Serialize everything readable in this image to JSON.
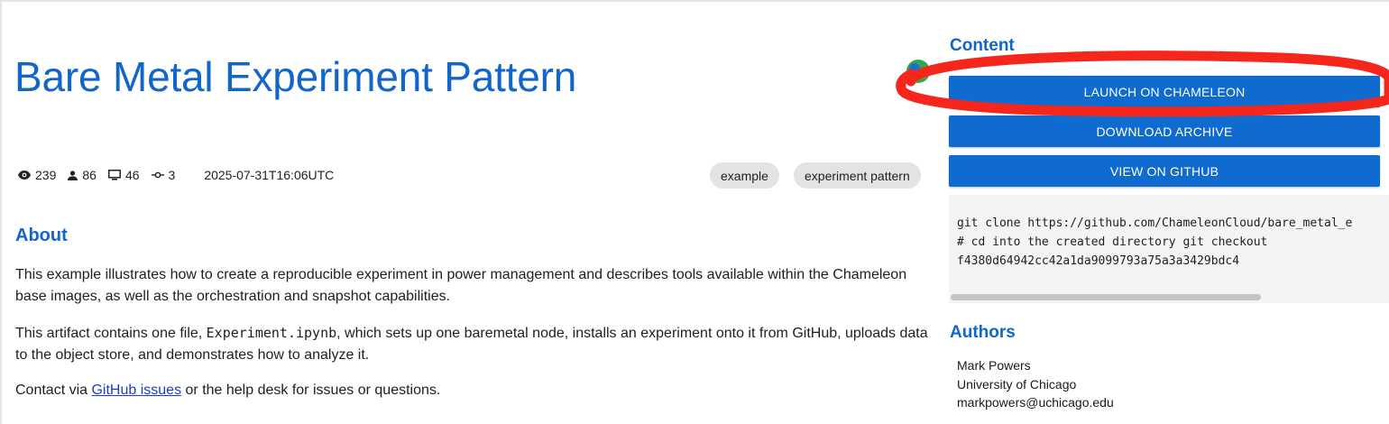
{
  "artifact": {
    "title": "Bare Metal Experiment Pattern",
    "stats": {
      "views": "239",
      "users": "86",
      "launches": "46",
      "versions": "3"
    },
    "date": "2025-07-31T16:06UTC",
    "tags": [
      "example",
      "experiment pattern"
    ]
  },
  "about": {
    "heading": "About",
    "p1": "This example illustrates how to create a reproducible experiment in power management and describes tools available within the Chameleon base images, as well as the orchestration and snapshot capabilities.",
    "p2_before": "This artifact contains one file, ",
    "p2_code": "Experiment.ipynb",
    "p2_after": ", which sets up one baremetal node, installs an experiment onto it from GitHub, uploads data to the object store, and demonstrates how to analyze it.",
    "p3_before": "Contact via ",
    "p3_link": "GitHub issues",
    "p3_after": " or the help desk for issues or questions."
  },
  "content": {
    "heading": "Content",
    "buttons": {
      "launch": "LAUNCH ON CHAMELEON",
      "download": "DOWNLOAD ARCHIVE",
      "github": "VIEW ON GITHUB"
    },
    "code": "git clone https://github.com/ChameleonCloud/bare_metal_e\n# cd into the created directory git checkout\nf4380d64942cc42a1da9099793a75a3a3429bdc4"
  },
  "authors": {
    "heading": "Authors",
    "name": "Mark Powers",
    "affiliation": "University of Chicago",
    "email": "markpowers@uchicago.edu"
  },
  "colors": {
    "accent": "#1266c9",
    "button": "#0f6bd0",
    "annotation": "#f5261b"
  },
  "icons": [
    "eye-icon",
    "person-icon",
    "monitor-icon",
    "commit-icon",
    "chameleon-logo-icon"
  ]
}
